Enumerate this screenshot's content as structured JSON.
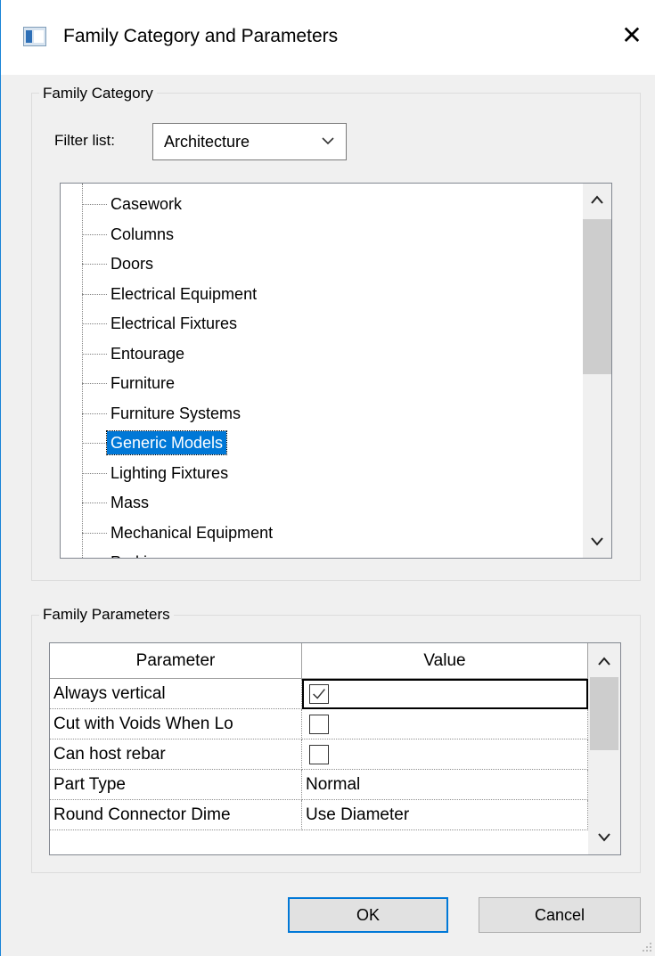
{
  "window": {
    "title": "Family Category and Parameters",
    "close_label": "✕"
  },
  "category_group": {
    "legend": "Family Category",
    "filter_label": "Filter list:",
    "filter_value": "Architecture",
    "items": [
      {
        "label": "Casework",
        "selected": false
      },
      {
        "label": "Columns",
        "selected": false
      },
      {
        "label": "Doors",
        "selected": false
      },
      {
        "label": "Electrical Equipment",
        "selected": false
      },
      {
        "label": "Electrical Fixtures",
        "selected": false
      },
      {
        "label": "Entourage",
        "selected": false
      },
      {
        "label": "Furniture",
        "selected": false
      },
      {
        "label": "Furniture Systems",
        "selected": false
      },
      {
        "label": "Generic Models",
        "selected": true
      },
      {
        "label": "Lighting Fixtures",
        "selected": false
      },
      {
        "label": "Mass",
        "selected": false
      },
      {
        "label": "Mechanical Equipment",
        "selected": false
      },
      {
        "label": "Parking",
        "selected": false
      }
    ]
  },
  "parameters_group": {
    "legend": "Family Parameters",
    "columns": [
      "Parameter",
      "Value"
    ],
    "rows": [
      {
        "parameter": "Always vertical",
        "type": "checkbox",
        "checked": true,
        "value": ""
      },
      {
        "parameter": "Cut with Voids When Lo",
        "type": "checkbox",
        "checked": false,
        "value": ""
      },
      {
        "parameter": "Can host rebar",
        "type": "checkbox",
        "checked": false,
        "value": ""
      },
      {
        "parameter": "Part Type",
        "type": "text",
        "checked": false,
        "value": "Normal"
      },
      {
        "parameter": "Round Connector Dime",
        "type": "text",
        "checked": false,
        "value": "Use Diameter"
      }
    ]
  },
  "buttons": {
    "ok": "OK",
    "cancel": "Cancel"
  },
  "colors": {
    "accent": "#0078d7",
    "window_border": "#1883d7",
    "background": "#f0f0f0"
  }
}
